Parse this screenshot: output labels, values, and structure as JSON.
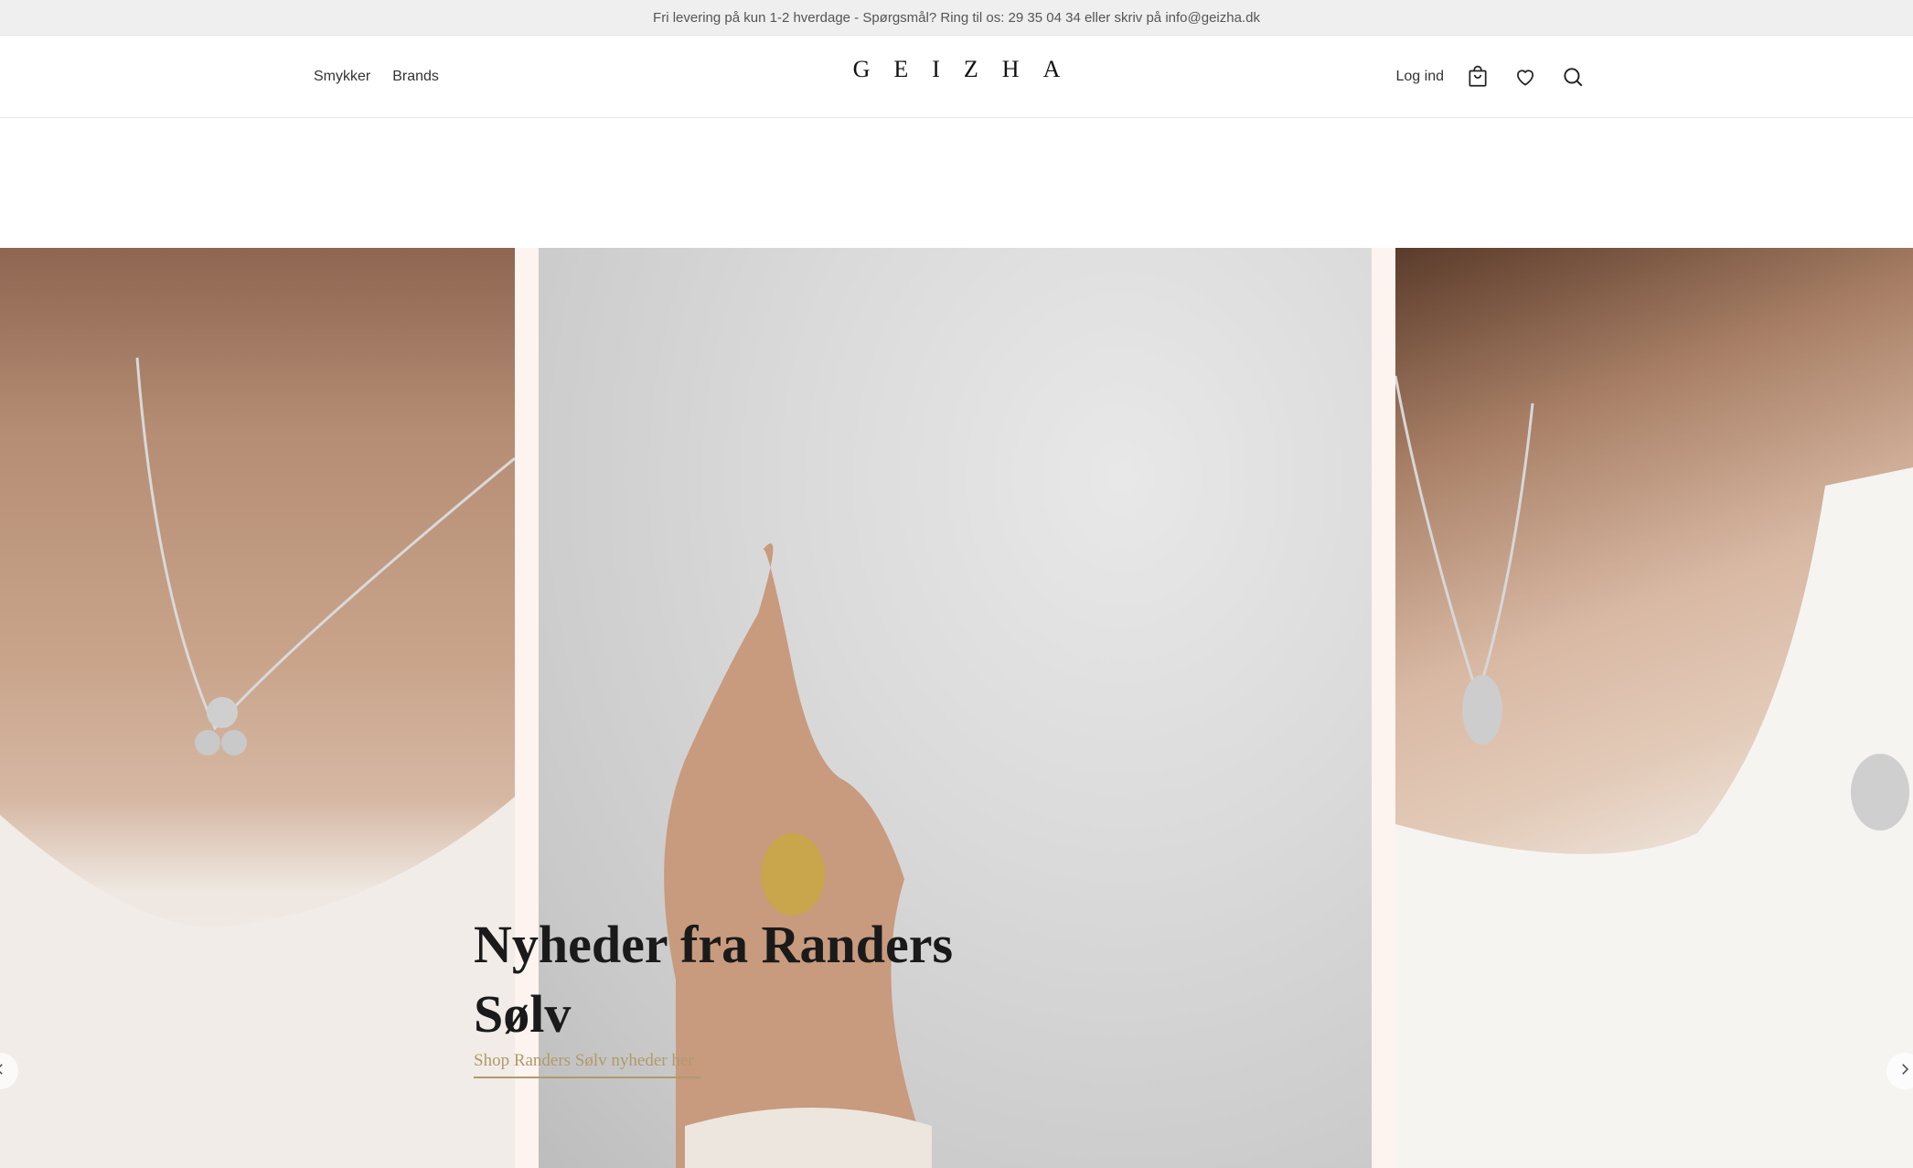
{
  "announcement": "Fri levering på kun 1-2 hverdage - Spørgsmål? Ring til os: 29 35 04 34 eller skriv på info@geizha.dk",
  "header": {
    "nav": [
      "Smykker",
      "Brands"
    ],
    "logo": "GEIZHA",
    "login_label": "Log ind",
    "icons": [
      "cart-icon",
      "heart-icon",
      "search-icon"
    ]
  },
  "hero": {
    "title_line1": "Nyheder fra Randers",
    "title_line2": "Sølv",
    "link_label": "Shop Randers Sølv nyheder her",
    "arrows": [
      "chevron-left-icon",
      "chevron-right-icon"
    ]
  },
  "colors": {
    "announcement_bg": "#efefef",
    "link_accent": "#b09a6a",
    "slide_gap": "#fdf3ef"
  }
}
